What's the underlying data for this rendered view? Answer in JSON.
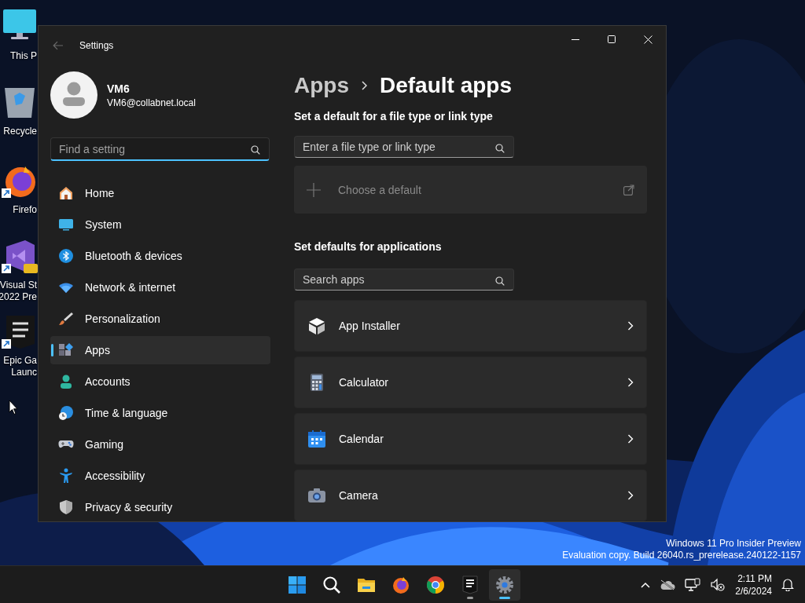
{
  "desktop": {
    "icons": [
      {
        "label": [
          "This P"
        ],
        "shortcut": false
      },
      {
        "label": [
          "Recycle"
        ],
        "shortcut": false
      },
      {
        "label": [
          "Firefo"
        ],
        "shortcut": true
      },
      {
        "label": [
          "Visual St",
          "2022 Pre"
        ],
        "shortcut": true
      },
      {
        "label": [
          "Epic Ga",
          "Launc"
        ],
        "shortcut": true
      }
    ],
    "watermark": [
      "Windows 11 Pro Insider Preview",
      "Evaluation copy. Build 26040.rs_prerelease.240122-1157"
    ]
  },
  "settings": {
    "title": "Settings",
    "back_disabled": true,
    "account": {
      "name": "VM6",
      "email": "VM6@collabnet.local"
    },
    "search": {
      "placeholder": "Find a setting",
      "focused": true
    },
    "nav": [
      {
        "label": "Home",
        "selected": false
      },
      {
        "label": "System",
        "selected": false
      },
      {
        "label": "Bluetooth & devices",
        "selected": false
      },
      {
        "label": "Network & internet",
        "selected": false
      },
      {
        "label": "Personalization",
        "selected": false
      },
      {
        "label": "Apps",
        "selected": true
      },
      {
        "label": "Accounts",
        "selected": false
      },
      {
        "label": "Time & language",
        "selected": false
      },
      {
        "label": "Gaming",
        "selected": false
      },
      {
        "label": "Accessibility",
        "selected": false
      },
      {
        "label": "Privacy & security",
        "selected": false
      }
    ],
    "breadcrumb": {
      "parent": "Apps",
      "current": "Default apps"
    },
    "file_type": {
      "heading": "Set a default for a file type or link type",
      "search": {
        "placeholder": "Enter a file type or link type"
      },
      "choose": "Choose a default"
    },
    "applications": {
      "heading": "Set defaults for applications",
      "search": {
        "placeholder": "Search apps"
      },
      "apps": [
        {
          "name": "App Installer"
        },
        {
          "name": "Calculator"
        },
        {
          "name": "Calendar"
        },
        {
          "name": "Camera"
        }
      ]
    }
  },
  "taskbar": {
    "apps": [
      {
        "running": false,
        "active": false
      },
      {
        "running": false,
        "active": false
      },
      {
        "running": false,
        "active": false
      },
      {
        "running": false,
        "active": false
      },
      {
        "running": false,
        "active": false
      },
      {
        "running": true,
        "active": false
      },
      {
        "running": true,
        "active": true
      }
    ],
    "clock": {
      "time": "2:11 PM",
      "date": "2/6/2024"
    }
  }
}
